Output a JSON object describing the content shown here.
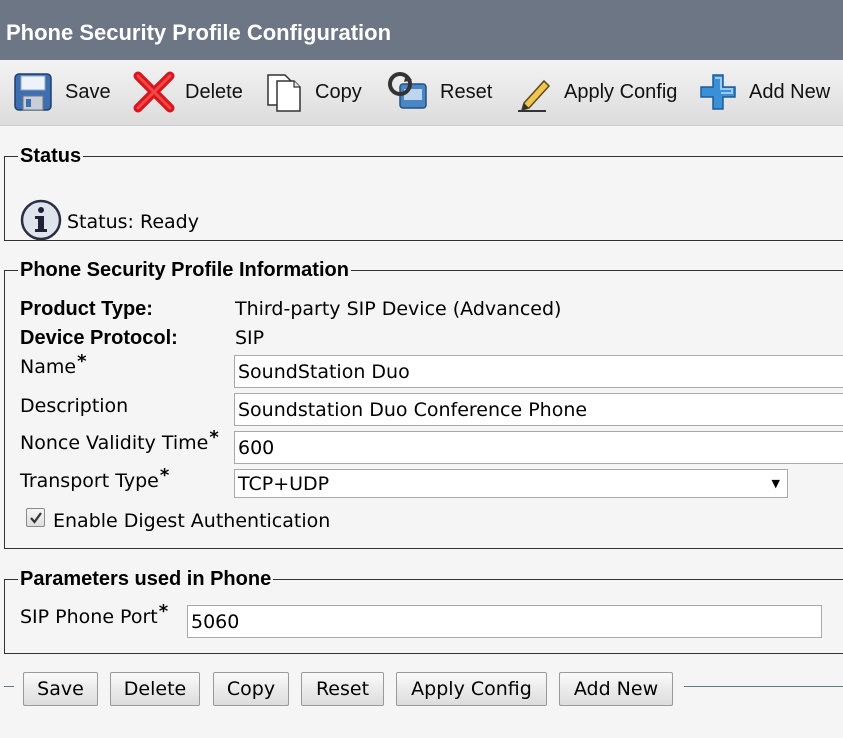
{
  "header": {
    "title": "Phone Security Profile Configuration"
  },
  "toolbar": {
    "items": [
      {
        "label": "Save",
        "icon": "save-icon"
      },
      {
        "label": "Delete",
        "icon": "delete-icon"
      },
      {
        "label": "Copy",
        "icon": "copy-icon"
      },
      {
        "label": "Reset",
        "icon": "reset-icon"
      },
      {
        "label": "Apply Config",
        "icon": "apply-config-icon"
      },
      {
        "label": "Add New",
        "icon": "add-new-icon"
      }
    ]
  },
  "status": {
    "legend": "Status",
    "text": "Status: Ready",
    "icon": "info-icon"
  },
  "profile": {
    "legend": "Phone Security Profile Information",
    "product_type_label": "Product Type:",
    "product_type_value": "Third-party SIP Device (Advanced)",
    "device_protocol_label": "Device Protocol:",
    "device_protocol_value": "SIP",
    "name_label": "Name",
    "name_value": "SoundStation Duo",
    "description_label": "Description",
    "description_value": "Soundstation Duo Conference Phone",
    "nonce_label": "Nonce Validity Time",
    "nonce_value": "600",
    "transport_label": "Transport Type",
    "transport_value": "TCP+UDP",
    "digest_label": "Enable Digest Authentication",
    "digest_checked": true,
    "required_marker": "*"
  },
  "params": {
    "legend": "Parameters used in Phone",
    "sip_port_label": "SIP Phone Port",
    "sip_port_value": "5060"
  },
  "bottom_buttons": {
    "save": "Save",
    "delete": "Delete",
    "copy": "Copy",
    "reset": "Reset",
    "apply_config": "Apply Config",
    "add_new": "Add New"
  },
  "colors": {
    "title_bar": "#6d7685",
    "page_bg": "#f5f5f5",
    "delete_red": "#d9161c",
    "add_blue": "#3a8fd6"
  }
}
